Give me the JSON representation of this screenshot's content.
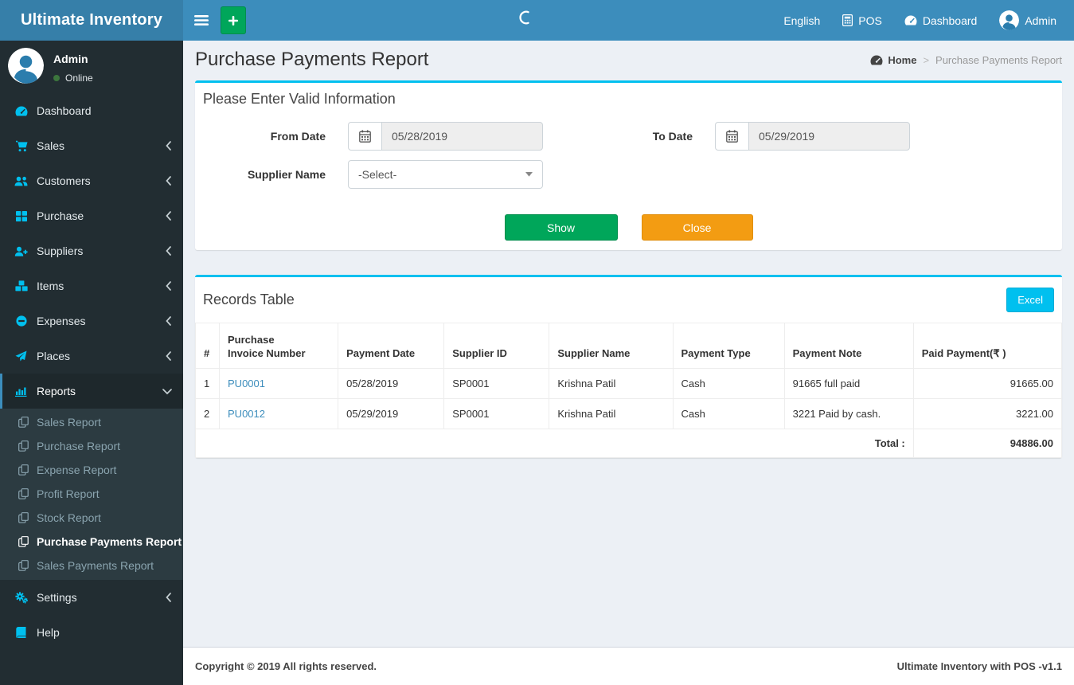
{
  "app": {
    "brand": "Ultimate Inventory"
  },
  "navbar": {
    "right_items": [
      {
        "id": "language",
        "label": "English",
        "icon": null
      },
      {
        "id": "pos",
        "label": "POS",
        "icon": "calculator-icon"
      },
      {
        "id": "dashboard",
        "label": "Dashboard",
        "icon": "dashboard-icon"
      },
      {
        "id": "admin",
        "label": "Admin",
        "icon": "avatar-icon"
      }
    ]
  },
  "sidebar": {
    "user": {
      "name": "Admin",
      "status": "Online"
    },
    "submenu_icon": "copy-icon",
    "items": [
      {
        "id": "dashboard",
        "label": "Dashboard",
        "icon": "dashboard-icon",
        "chevron": null,
        "active": false
      },
      {
        "id": "sales",
        "label": "Sales",
        "icon": "cart-icon",
        "chevron": "left",
        "active": false
      },
      {
        "id": "customers",
        "label": "Customers",
        "icon": "users-icon",
        "chevron": "left",
        "active": false
      },
      {
        "id": "purchase",
        "label": "Purchase",
        "icon": "grid-icon",
        "chevron": "left",
        "active": false
      },
      {
        "id": "suppliers",
        "label": "Suppliers",
        "icon": "user-plus-icon",
        "chevron": "left",
        "active": false
      },
      {
        "id": "items",
        "label": "Items",
        "icon": "cubes-icon",
        "chevron": "left",
        "active": false
      },
      {
        "id": "expenses",
        "label": "Expenses",
        "icon": "minus-circle-icon",
        "chevron": "left",
        "active": false
      },
      {
        "id": "places",
        "label": "Places",
        "icon": "send-icon",
        "chevron": "left",
        "active": false
      },
      {
        "id": "reports",
        "label": "Reports",
        "icon": "bar-chart-icon",
        "chevron": "down",
        "active": true,
        "children": [
          {
            "id": "sales-report",
            "label": "Sales Report",
            "active": false
          },
          {
            "id": "purchase-report",
            "label": "Purchase Report",
            "active": false
          },
          {
            "id": "expense-report",
            "label": "Expense Report",
            "active": false
          },
          {
            "id": "profit-report",
            "label": "Profit Report",
            "active": false
          },
          {
            "id": "stock-report",
            "label": "Stock Report",
            "active": false
          },
          {
            "id": "purchase-payments-report",
            "label": "Purchase Payments Report",
            "active": true
          },
          {
            "id": "sales-payments-report",
            "label": "Sales Payments Report",
            "active": false
          }
        ]
      },
      {
        "id": "settings",
        "label": "Settings",
        "icon": "gears-icon",
        "chevron": "left",
        "active": false
      },
      {
        "id": "help",
        "label": "Help",
        "icon": "book-icon",
        "chevron": null,
        "active": false
      }
    ]
  },
  "page": {
    "title": "Purchase Payments Report",
    "breadcrumb": {
      "home": "Home",
      "separator": ">",
      "current": "Purchase Payments Report"
    }
  },
  "filter_box": {
    "title": "Please Enter Valid Information",
    "from_date": {
      "label": "From Date",
      "value": "05/28/2019"
    },
    "to_date": {
      "label": "To Date",
      "value": "05/29/2019"
    },
    "supplier": {
      "label": "Supplier Name",
      "value": "-Select-"
    },
    "show_button": "Show",
    "close_button": "Close"
  },
  "records_box": {
    "title": "Records Table",
    "excel_button": "Excel",
    "table": {
      "columns": [
        "#",
        "Purchase\nInvoice Number",
        "Payment Date",
        "Supplier ID",
        "Supplier Name",
        "Payment Type",
        "Payment Note",
        "Paid Payment(₹ )"
      ],
      "rows": [
        {
          "num": "1",
          "invoice": "PU0001",
          "payment_date": "05/28/2019",
          "supplier_id": "SP0001",
          "supplier_name": "Krishna Patil",
          "payment_type": "Cash",
          "payment_note": "91665 full paid",
          "paid": "91665.00"
        },
        {
          "num": "2",
          "invoice": "PU0012",
          "payment_date": "05/29/2019",
          "supplier_id": "SP0001",
          "supplier_name": "Krishna Patil",
          "payment_type": "Cash",
          "payment_note": "3221 Paid by cash.",
          "paid": "3221.00"
        }
      ],
      "total_label": "Total :",
      "total_value": "94886.00"
    }
  },
  "footer": {
    "left": "Copyright © 2019 All rights reserved.",
    "right": "Ultimate Inventory with POS -v1.1"
  },
  "colors": {
    "navbar": "#3c8dbc",
    "logo_bg": "#367fa9",
    "sidebar": "#222d32",
    "submenu_bg": "#2c3b41",
    "accent_cyan": "#00c0ef",
    "success_green": "#00a65a",
    "warning_orange": "#f39c12",
    "link_blue": "#3c8dbc"
  }
}
